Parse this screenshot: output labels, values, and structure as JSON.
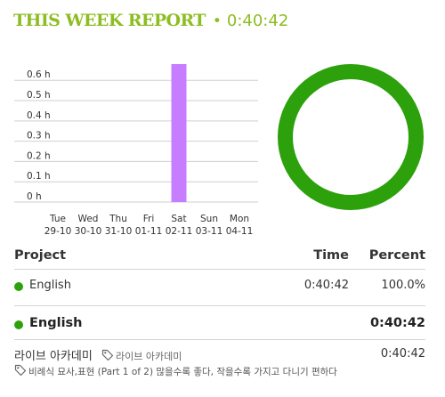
{
  "report": {
    "title": "THIS WEEK REPORT",
    "separator": "•",
    "total_time": "0:40:42",
    "accent_color": "#8cbd22"
  },
  "chart_data": {
    "type": "bar",
    "categories": [
      "Tue\n29-10",
      "Wed\n30-10",
      "Thu\n31-10",
      "Fri\n01-11",
      "Sat\n02-11",
      "Sun\n03-11",
      "Mon\n04-11"
    ],
    "values": [
      0,
      0,
      0,
      0,
      0.68,
      0,
      0
    ],
    "yticks": [
      0,
      0.1,
      0.2,
      0.3,
      0.4,
      0.5,
      0.6
    ],
    "ytick_labels": [
      "0 h",
      "0.1 h",
      "0.2 h",
      "0.3 h",
      "0.4 h",
      "0.5 h",
      "0.6 h"
    ],
    "ylim": [
      0,
      0.68
    ],
    "grid": true,
    "bar_color": "#c77dff"
  },
  "donut": {
    "segments": [
      {
        "value": 100.0,
        "color": "#2ca10c"
      }
    ]
  },
  "table": {
    "headers": {
      "project": "Project",
      "time": "Time",
      "percent": "Percent"
    },
    "rows": [
      {
        "name": "English",
        "time": "0:40:42",
        "percent": "100.0%",
        "color": "#2ca10c"
      }
    ]
  },
  "group": {
    "name": "English",
    "time": "0:40:42",
    "color": "#2ca10c"
  },
  "entries": [
    {
      "title": "라이브 아카데미",
      "tag": "라이브 아카데미",
      "time": "0:40:42",
      "description": "비례식 묘사,표현 (Part 1 of 2) 많을수록 좋다, 작을수록 가지고 다니기 편하다"
    }
  ]
}
